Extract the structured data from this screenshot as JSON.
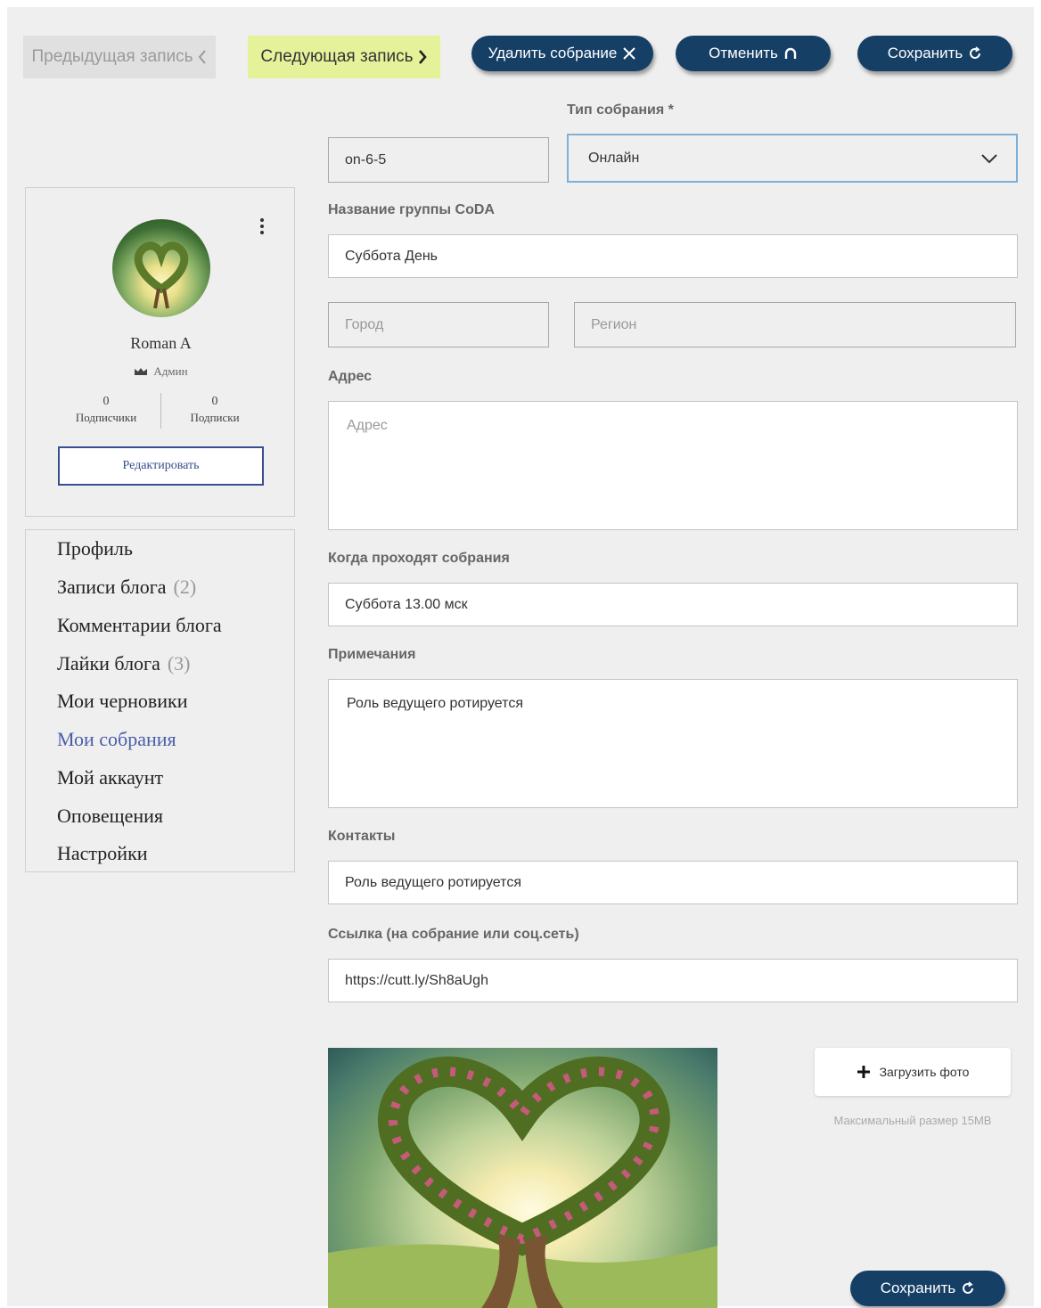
{
  "nav": {
    "prev_label": "Предыдущая запись",
    "next_label": "Следующая запись",
    "delete_label": "Удалить собрание",
    "cancel_label": "Отменить",
    "save_label": "Сохранить"
  },
  "profile": {
    "name": "Roman A",
    "role": "Админ",
    "followers_count": "0",
    "followers_label": "Подписчики",
    "following_count": "0",
    "following_label": "Подписки",
    "edit_label": "Редактировать"
  },
  "menu": {
    "items": [
      {
        "label": "Профиль",
        "count": ""
      },
      {
        "label": "Записи блога",
        "count": "(2)"
      },
      {
        "label": "Комментарии блога",
        "count": ""
      },
      {
        "label": "Лайки блога",
        "count": "(3)"
      },
      {
        "label": "Мои черновики",
        "count": ""
      },
      {
        "label": "Мои собрания",
        "count": "",
        "active": true
      },
      {
        "label": "Мой аккаунт",
        "count": ""
      },
      {
        "label": "Оповещения",
        "count": ""
      },
      {
        "label": "Настройки",
        "count": ""
      }
    ]
  },
  "form": {
    "meeting_type_label": "Тип собрания *",
    "meeting_code": "on-6-5",
    "meeting_type_value": "Онлайн",
    "group_name_label": "Название группы CoDA",
    "group_name_value": "Суббота День",
    "city_placeholder": "Город",
    "region_placeholder": "Регион",
    "address_label": "Адрес",
    "address_placeholder": "Адрес",
    "when_label": "Когда проходят собрания",
    "when_value": "Суббота 13.00 мск",
    "notes_label": "Примечания",
    "notes_value": "Роль ведущего ротируется",
    "contacts_label": "Контакты",
    "contacts_value": "Роль ведущего ротируется",
    "link_label": "Ссылка (на собрание или соц.сеть)",
    "link_value": "https://cutt.ly/Sh8aUgh",
    "upload_label": "Загрузить фото",
    "max_size": "Максимальный размер 15MB",
    "save_bottom_label": "Сохранить"
  },
  "colors": {
    "primary": "#163f66",
    "next_bg": "#e6f29a",
    "page_bg": "#efefef",
    "active_menu": "#4a5ea8"
  }
}
